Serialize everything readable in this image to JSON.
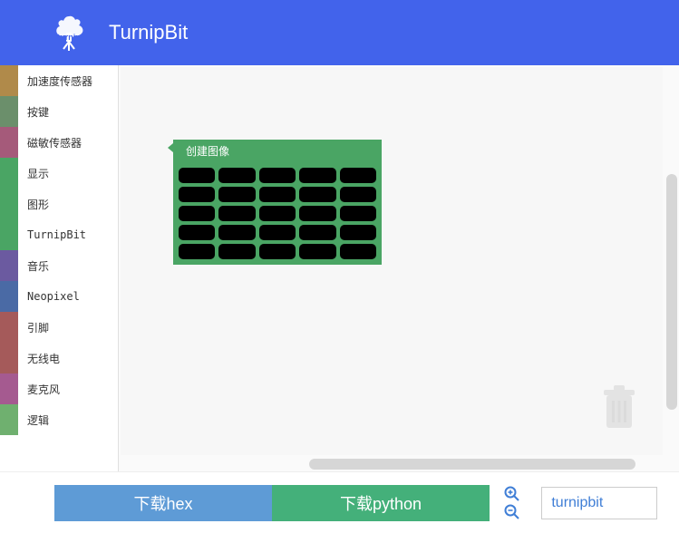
{
  "header": {
    "app_title": "TurnipBit"
  },
  "sidebar": {
    "categories": [
      {
        "label": "加速度传感器",
        "color": "#b08a4a"
      },
      {
        "label": "按键",
        "color": "#6b8f6b"
      },
      {
        "label": "磁敏传感器",
        "color": "#a55a7a"
      },
      {
        "label": "显示",
        "color": "#4aa564"
      },
      {
        "label": "图形",
        "color": "#4aa564"
      },
      {
        "label": "TurnipBit",
        "color": "#4aa564"
      },
      {
        "label": "音乐",
        "color": "#6b5aa0"
      },
      {
        "label": "Neopixel",
        "color": "#4a6aa5"
      },
      {
        "label": "引脚",
        "color": "#a55a5a"
      },
      {
        "label": "无线电",
        "color": "#a55a5a"
      },
      {
        "label": "麦克风",
        "color": "#a55a90"
      },
      {
        "label": "逻辑",
        "color": "#6fb06f"
      }
    ]
  },
  "workspace": {
    "block": {
      "title": "创建图像",
      "grid_rows": 5,
      "grid_cols": 5
    }
  },
  "footer": {
    "download_hex_label": "下载hex",
    "download_python_label": "下载python",
    "filename": "turnipbit"
  },
  "icons": {
    "trash": "trash-icon",
    "zoom_in": "zoom-in-icon",
    "zoom_out": "zoom-out-icon"
  }
}
